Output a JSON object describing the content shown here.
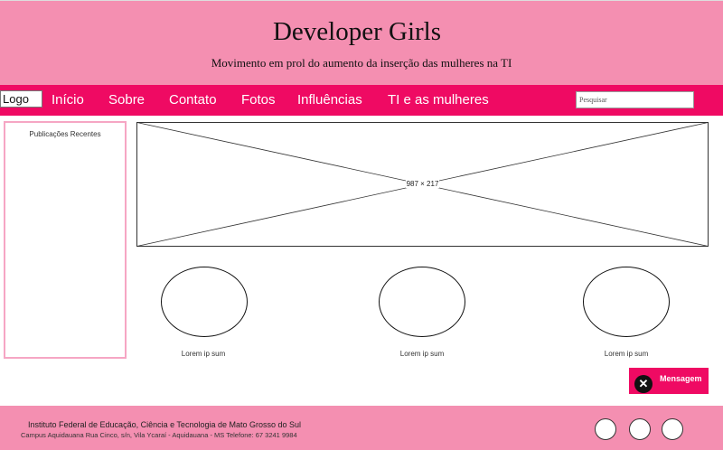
{
  "header": {
    "title": "Developer Girls",
    "subtitle": "Movimento em prol do aumento da inserção das mulheres na TI"
  },
  "nav": {
    "logo": "Logo",
    "items": [
      "Início",
      "Sobre",
      "Contato",
      "Fotos",
      "Influências",
      "TI e as mulheres"
    ],
    "search_placeholder": "Pesquisar"
  },
  "sidebar": {
    "title": "Publicações Recentes"
  },
  "banner": {
    "placeholder_label": "987 × 217"
  },
  "features": [
    {
      "caption": "Lorem ip sum"
    },
    {
      "caption": "Lorem ip sum"
    },
    {
      "caption": "Lorem ip sum"
    }
  ],
  "message_button": {
    "label": "Mensagem",
    "icon": "close-icon"
  },
  "footer": {
    "institution": "Instituto Federal de Educação, Ciência e Tecnologia de Mato Grosso do Sul",
    "address": "Campus Aquidauana Rua Cinco, s/n, Vila Ycaraí - Aquidauana - MS Telefone: 67 3241 9984"
  },
  "colors": {
    "header_pink": "#f48fb1",
    "nav_pink": "#ef0a63",
    "sidebar_border": "#f6a6c4"
  }
}
